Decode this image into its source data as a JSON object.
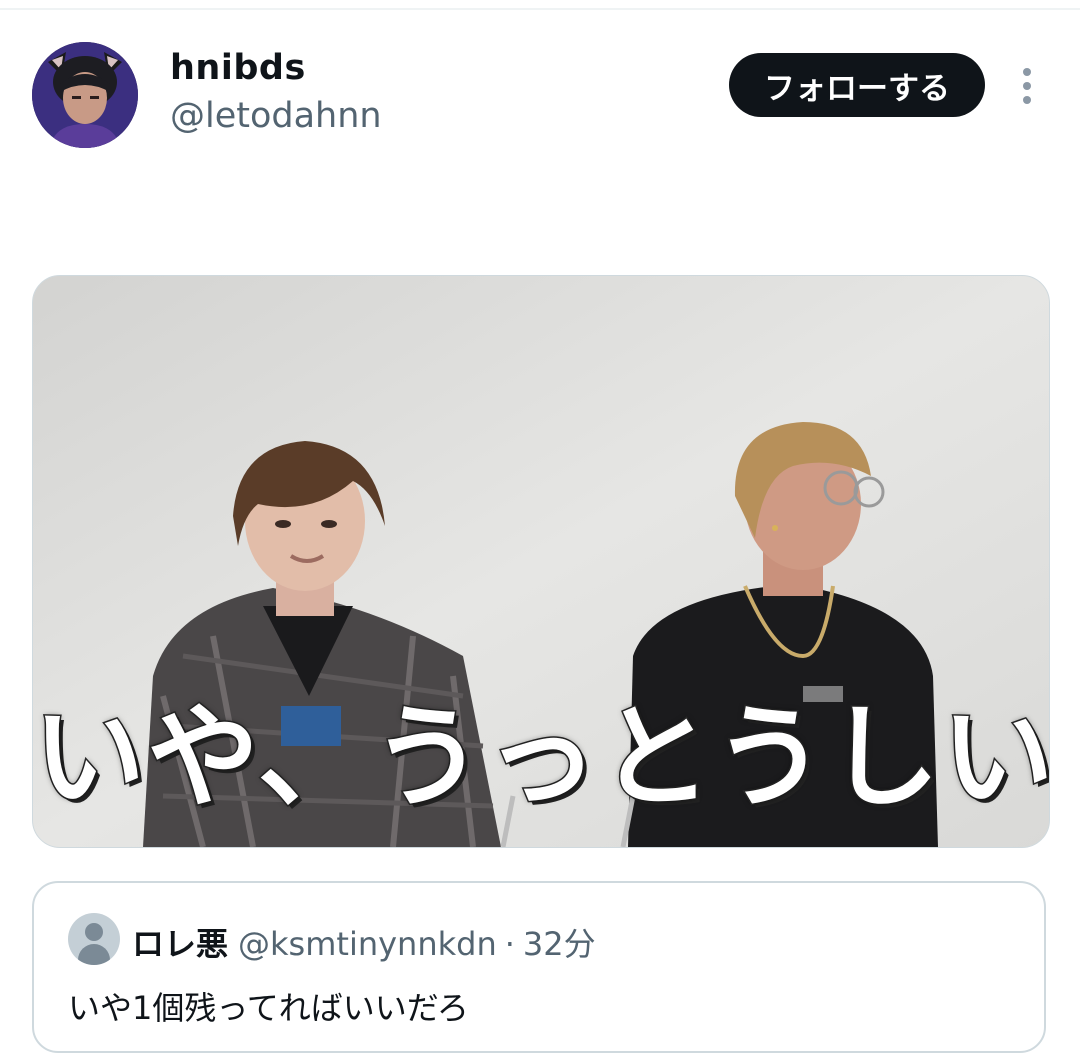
{
  "post": {
    "display_name": "hnibds",
    "handle": "@letodahnn",
    "follow_label": "フォローする",
    "more_icon": "more-vertical-icon"
  },
  "media": {
    "caption": "いや、うっとうしいな",
    "accent_caption_color": "#ffffff"
  },
  "quote": {
    "name": "ロレ悪",
    "handle": "@ksmtinynnkdn",
    "separator": "·",
    "time": "32分",
    "text": "いや1個残ってればいいだろ",
    "avatar_icon": "default-user-icon"
  },
  "colors": {
    "primary_text": "#0f1419",
    "secondary_text": "#536471",
    "follow_button_bg": "#0f1419",
    "border": "#cfd9de"
  }
}
